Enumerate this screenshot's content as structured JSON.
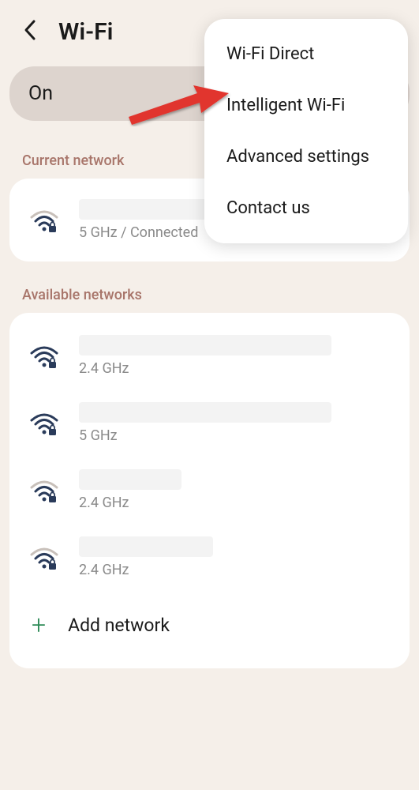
{
  "header": {
    "title": "Wi-Fi"
  },
  "toggle": {
    "label": "On"
  },
  "sections": {
    "current_label": "Current network",
    "available_label": "Available networks"
  },
  "current_network": {
    "sub": "5 GHz / Connected"
  },
  "available_networks": [
    {
      "sub": "2.4 GHz"
    },
    {
      "sub": "5 GHz"
    },
    {
      "sub": "2.4 GHz"
    },
    {
      "sub": "2.4 GHz"
    }
  ],
  "add_network": {
    "label": "Add network"
  },
  "popup": {
    "items": [
      "Wi-Fi Direct",
      "Intelligent Wi-Fi",
      "Advanced settings",
      "Contact us"
    ]
  }
}
